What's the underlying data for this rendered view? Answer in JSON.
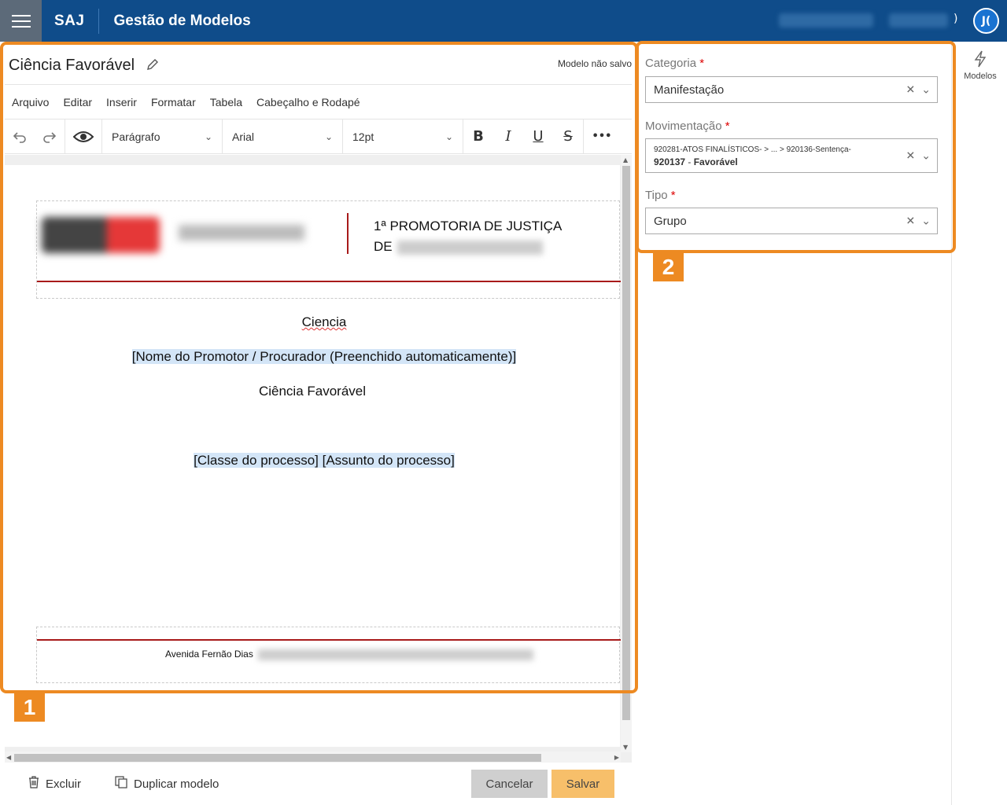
{
  "header": {
    "brand": "SAJ",
    "app_title": "Gestão de Modelos",
    "avatar_initials": "J(",
    "paren": ")"
  },
  "document": {
    "title": "Ciência Favorável",
    "status": "Modelo não salvo"
  },
  "menu": [
    "Arquivo",
    "Editar",
    "Inserir",
    "Formatar",
    "Tabela",
    "Cabeçalho e Rodapé"
  ],
  "toolbar": {
    "paragraph": "Parágrafo",
    "font": "Arial",
    "size": "12pt",
    "bold": "B",
    "italic": "I",
    "underline": "U",
    "strike": "S",
    "more": "•••"
  },
  "page": {
    "promotoria_line1": "1ª PROMOTORIA DE JUSTIÇA",
    "promotoria_line2": "DE",
    "line_ciencia": "Ciencia",
    "line_nome": "[Nome do Promotor / Procurador (Preenchido automaticamente)]",
    "line_favoravel": "Ciência Favorável",
    "line_classe": "[Classe do processo] [Assunto do processo]",
    "footer_address": "Avenida Fernão Dias"
  },
  "form": {
    "categoria_label": "Categoria",
    "categoria_value": "Manifestação",
    "movimentacao_label": "Movimentação",
    "movimentacao_path": "920281-ATOS FINALÍSTICOS- > ... > 920136-Sentença-",
    "movimentacao_code": "920137",
    "movimentacao_sep": " - ",
    "movimentacao_name": "Favorável",
    "tipo_label": "Tipo",
    "tipo_value": "Grupo",
    "required_mark": "*"
  },
  "side": {
    "modelos_label": "Modelos"
  },
  "callouts": {
    "one": "1",
    "two": "2"
  },
  "actions": {
    "excluir": "Excluir",
    "duplicar": "Duplicar modelo",
    "cancelar": "Cancelar",
    "salvar": "Salvar"
  },
  "colors": {
    "topbar": "#0f4c8a",
    "accent": "#ed8a22",
    "save": "#f7bf6a"
  }
}
